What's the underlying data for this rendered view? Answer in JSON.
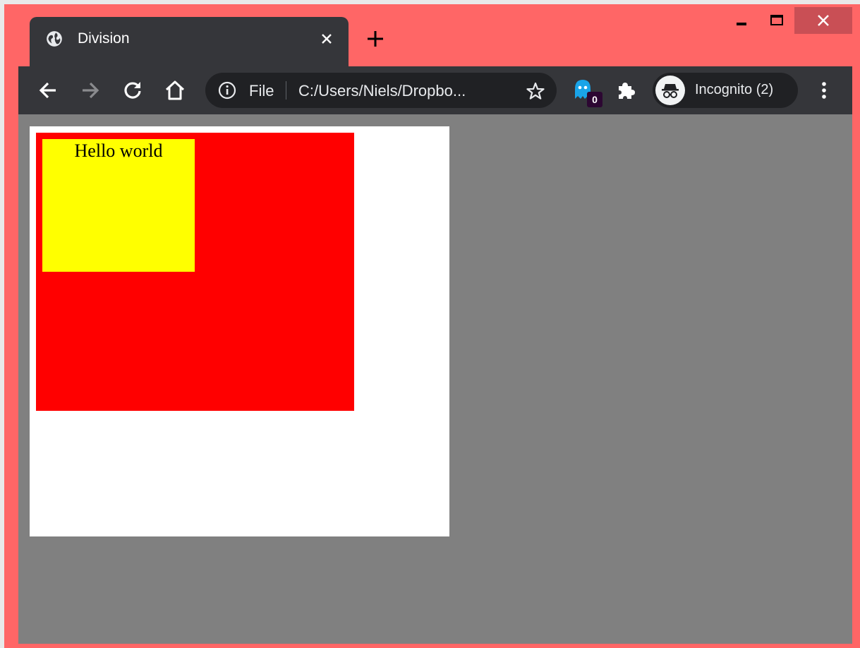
{
  "browser": {
    "tab": {
      "title": "Division",
      "favicon": "globe-icon"
    },
    "window_controls": [
      "minimize-icon",
      "maximize-icon",
      "close-icon"
    ],
    "toolbar": {
      "nav_icons": [
        "back-arrow-icon",
        "forward-arrow-icon",
        "reload-icon",
        "home-icon"
      ],
      "omnibox": {
        "scheme_label": "File",
        "url": "C:/Users/Niels/Dropbo...",
        "info_icon": "info-icon",
        "star_icon": "star-icon"
      },
      "extensions": {
        "ghostery_badge": "0",
        "puzzle_icon": "extensions-icon"
      },
      "profile": {
        "label": "Incognito (2)",
        "icon": "incognito-icon"
      },
      "menu_icon": "kebab-menu-icon"
    },
    "colors": {
      "frame": "#ff6666",
      "toolbar": "#35363a",
      "omnibox": "#202124"
    }
  },
  "page": {
    "background": "#808080",
    "outer_box_color": "#ffffff",
    "middle_box_color": "#ff0000",
    "inner_box_color": "#ffff00",
    "inner_text": "Hello world"
  }
}
